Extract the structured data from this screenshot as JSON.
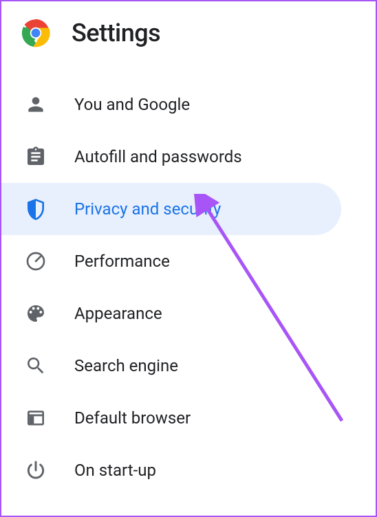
{
  "header": {
    "title": "Settings"
  },
  "nav": {
    "items": [
      {
        "id": "you-and-google",
        "label": "You and Google",
        "icon": "person-icon",
        "selected": false
      },
      {
        "id": "autofill",
        "label": "Autofill and passwords",
        "icon": "clipboard-icon",
        "selected": false
      },
      {
        "id": "privacy",
        "label": "Privacy and security",
        "icon": "shield-icon",
        "selected": true
      },
      {
        "id": "performance",
        "label": "Performance",
        "icon": "gauge-icon",
        "selected": false
      },
      {
        "id": "appearance",
        "label": "Appearance",
        "icon": "palette-icon",
        "selected": false
      },
      {
        "id": "search-engine",
        "label": "Search engine",
        "icon": "search-icon",
        "selected": false
      },
      {
        "id": "default-browser",
        "label": "Default browser",
        "icon": "window-icon",
        "selected": false
      },
      {
        "id": "on-startup",
        "label": "On start-up",
        "icon": "power-icon",
        "selected": false
      }
    ]
  },
  "annotation": {
    "arrow_color": "#a855f7"
  }
}
